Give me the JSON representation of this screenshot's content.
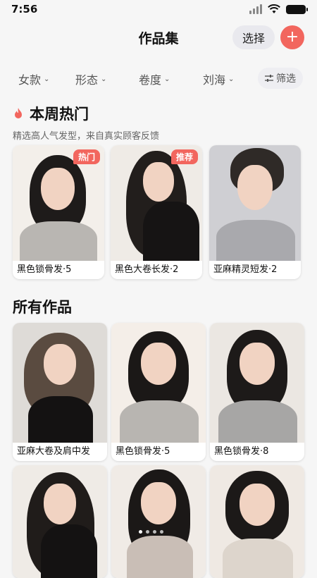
{
  "status": {
    "time": "7:56"
  },
  "nav": {
    "title": "作品集",
    "select_label": "选择",
    "add_label": "+"
  },
  "filters": {
    "items": [
      "女款",
      "形态",
      "卷度",
      "刘海"
    ],
    "filter_button": "筛选"
  },
  "hot_section": {
    "title": "本周热门",
    "subtitle": "精选高人气发型，来自真实顾客反馈",
    "cards": [
      {
        "label": "黑色锁骨发·5",
        "badge": "热门"
      },
      {
        "label": "黑色大卷长发·2",
        "badge": "推荐"
      },
      {
        "label": "亚麻精灵短发·2",
        "badge": ""
      }
    ]
  },
  "all_section": {
    "title": "所有作品",
    "cards": [
      {
        "label": "亚麻大卷及肩中发"
      },
      {
        "label": "黑色锁骨发·5"
      },
      {
        "label": "黑色锁骨发·8"
      },
      {
        "label": ""
      },
      {
        "label": ""
      },
      {
        "label": ""
      }
    ]
  },
  "colors": {
    "accent": "#f2665e"
  }
}
